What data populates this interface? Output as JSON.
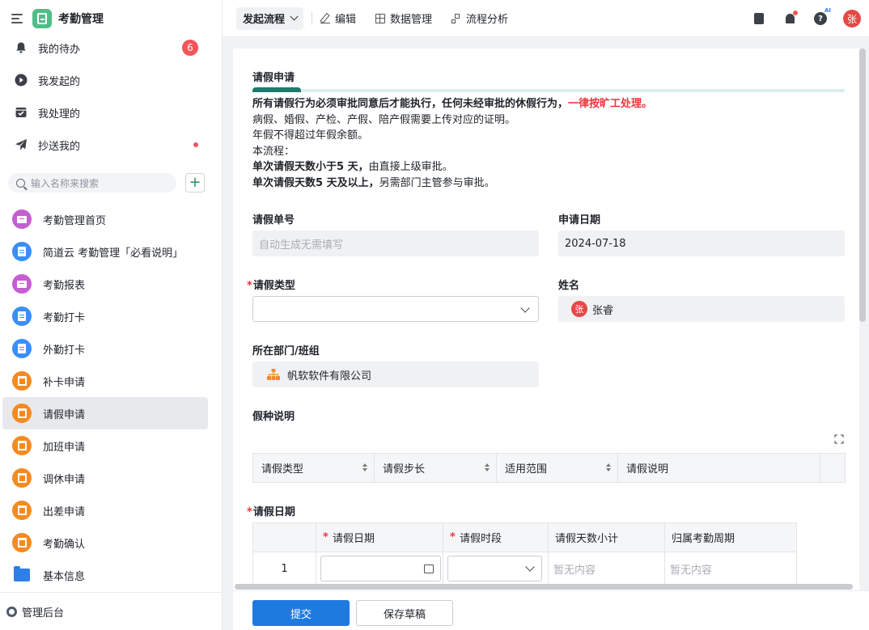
{
  "sidebar": {
    "app_title": "考勤管理",
    "nav": [
      {
        "label": "我的待办",
        "icon": "bell-icon",
        "badge": "6"
      },
      {
        "label": "我发起的",
        "icon": "play-icon"
      },
      {
        "label": "我处理的",
        "icon": "inbox-check-icon"
      },
      {
        "label": "抄送我的",
        "icon": "paper-plane-icon",
        "dot": true
      }
    ],
    "search_placeholder": "输入名称来搜索",
    "apps": [
      {
        "label": "考勤管理首页",
        "icon": "dashboard-icon",
        "color": "purple"
      },
      {
        "label": "简道云 考勤管理「必看说明」",
        "icon": "document-icon",
        "color": "blue"
      },
      {
        "label": "考勤报表",
        "icon": "dashboard-icon",
        "color": "purple"
      },
      {
        "label": "考勤打卡",
        "icon": "document-icon",
        "color": "blue"
      },
      {
        "label": "外勤打卡",
        "icon": "document-icon",
        "color": "blue"
      },
      {
        "label": "补卡申请",
        "icon": "workflow-icon",
        "color": "orange"
      },
      {
        "label": "请假申请",
        "icon": "workflow-icon",
        "color": "orange",
        "active": true
      },
      {
        "label": "加班申请",
        "icon": "workflow-icon",
        "color": "orange"
      },
      {
        "label": "调休申请",
        "icon": "workflow-icon",
        "color": "orange"
      },
      {
        "label": "出差申请",
        "icon": "workflow-icon",
        "color": "orange"
      },
      {
        "label": "考勤确认",
        "icon": "workflow-icon",
        "color": "orange"
      },
      {
        "label": "基本信息",
        "icon": "folder-icon",
        "color": "folder"
      }
    ],
    "footer_label": "管理后台"
  },
  "topbar": {
    "launch_label": "发起流程",
    "edit_label": "编辑",
    "data_label": "数据管理",
    "flow_label": "流程分析",
    "avatar_text": "张",
    "ai_tag": "AI"
  },
  "form": {
    "section_title": "请假申请",
    "desc": {
      "line1_bold": "所有请假行为必须审批同意后才能执行，任何未经审批的休假行为，",
      "line1_red": "一律按旷工处理。",
      "line2": "病假、婚假、产检、产假、陪产假需要上传对应的证明。",
      "line3": "年假不得超过年假余额。",
      "line4": "本流程：",
      "line5_bold": "单次请假天数小于5 天，",
      "line5_rest": "由直接上级审批。",
      "line6_bold": "单次请假天数5 天及以上，",
      "line6_rest": "另需部门主管参与审批。"
    },
    "order_no_label": "请假单号",
    "order_no_placeholder": "自动生成无需填写",
    "apply_date_label": "申请日期",
    "apply_date_value": "2024-07-18",
    "leave_type_label": "请假类型",
    "name_label": "姓名",
    "name_avatar": "张",
    "name_value": "张睿",
    "dept_label": "所在部门/班组",
    "dept_value": "帆软软件有限公司",
    "leave_kind_label": "假种说明",
    "kind_table_headers": [
      "请假类型",
      "请假步长",
      "适用范围",
      "请假说明"
    ],
    "leave_date_label": "请假日期",
    "date_table": {
      "headers": [
        "",
        "请假日期",
        "请假时段",
        "请假天数小计",
        "归属考勤周期"
      ],
      "row_index": "1",
      "empty1": "暂无内容",
      "empty2": "暂无内容"
    }
  },
  "actions": {
    "submit": "提交",
    "save_draft": "保存草稿"
  }
}
